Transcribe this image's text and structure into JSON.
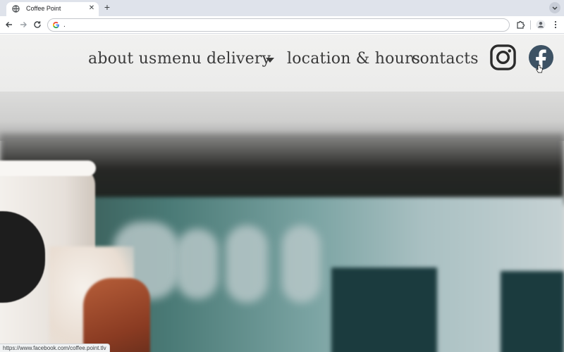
{
  "browser": {
    "tab_title": "Coffee Point",
    "tab_close": "✕",
    "new_tab": "+",
    "address_text": ".",
    "status_url": "https://www.facebook.com/coffee.point.tlv"
  },
  "site": {
    "nav": {
      "about": "about us",
      "menu": "menu",
      "delivery": "delivery",
      "location": "location & hours",
      "contacts": "contacts"
    },
    "social": {
      "instagram_icon": "instagram-icon",
      "facebook_icon": "facebook-icon"
    }
  },
  "colors": {
    "header_bg": "#eeeeed",
    "nav_text": "#3a3a3a",
    "facebook_circle": "#3d5264",
    "chrome_bg": "#dfe3eb"
  }
}
